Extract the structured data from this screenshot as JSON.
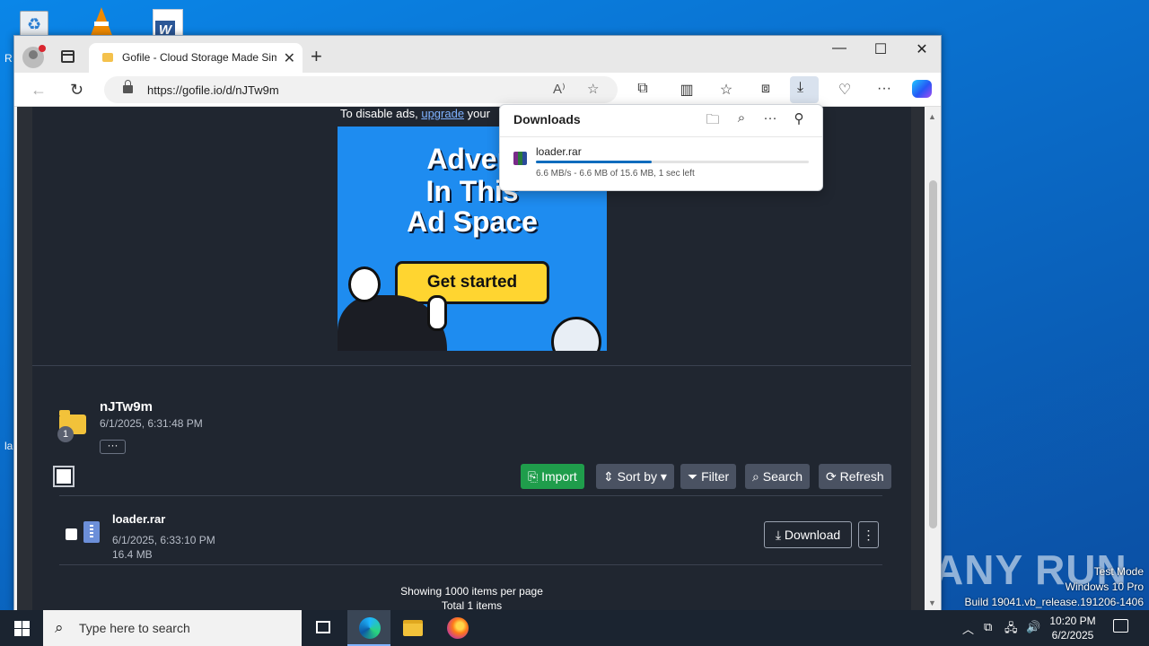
{
  "desktop": {
    "edge_letters": [
      "R",
      "la"
    ],
    "watermark": {
      "logo": "ANY RUN",
      "line1": "Test Mode",
      "line2": "Windows 10 Pro",
      "line3": "Build 19041.vb_release.191206-1406"
    }
  },
  "browser": {
    "tab": {
      "title": "Gofile - Cloud Storage Made Simple",
      "close": "✕"
    },
    "new_tab": "+",
    "window_controls": {
      "minimize": "—",
      "maximize": "☐",
      "close": "✕"
    },
    "address": {
      "url": "https://gofile.io/d/nJTw9m"
    }
  },
  "page": {
    "ad_note": {
      "prefix": "To disable ads, ",
      "link": "upgrade",
      "suffix": " your"
    },
    "ad_banner": {
      "line1": "Advert",
      "line2": "In This",
      "line3": "Ad Space",
      "cta": "Get started"
    },
    "folder": {
      "name": "nJTw9m",
      "date": "6/1/2025, 6:31:48 PM",
      "badge": "1",
      "more": "···"
    },
    "actions": {
      "import": "Import",
      "sort_by": "Sort by",
      "filter": "Filter",
      "search": "Search",
      "refresh": "Refresh"
    },
    "file": {
      "name": "loader.rar",
      "date": "6/1/2025, 6:33:10 PM",
      "size": "16.4 MB",
      "download": "Download",
      "menu": "⋮"
    },
    "footer": {
      "per_page": "Showing 1000 items per page",
      "total": "Total 1 items"
    }
  },
  "downloads": {
    "title": "Downloads",
    "item": {
      "filename": "loader.rar",
      "status": "6.6 MB/s - 6.6 MB of 15.6 MB, 1 sec left",
      "progress_fraction": 0.423
    }
  },
  "taskbar": {
    "search_placeholder": "Type here to search",
    "time": "10:20 PM",
    "date": "6/2/2025"
  },
  "colors": {
    "accent_green": "#1f9d4b",
    "download_progress": "#0f6cbd",
    "page_bg": "#202630"
  }
}
